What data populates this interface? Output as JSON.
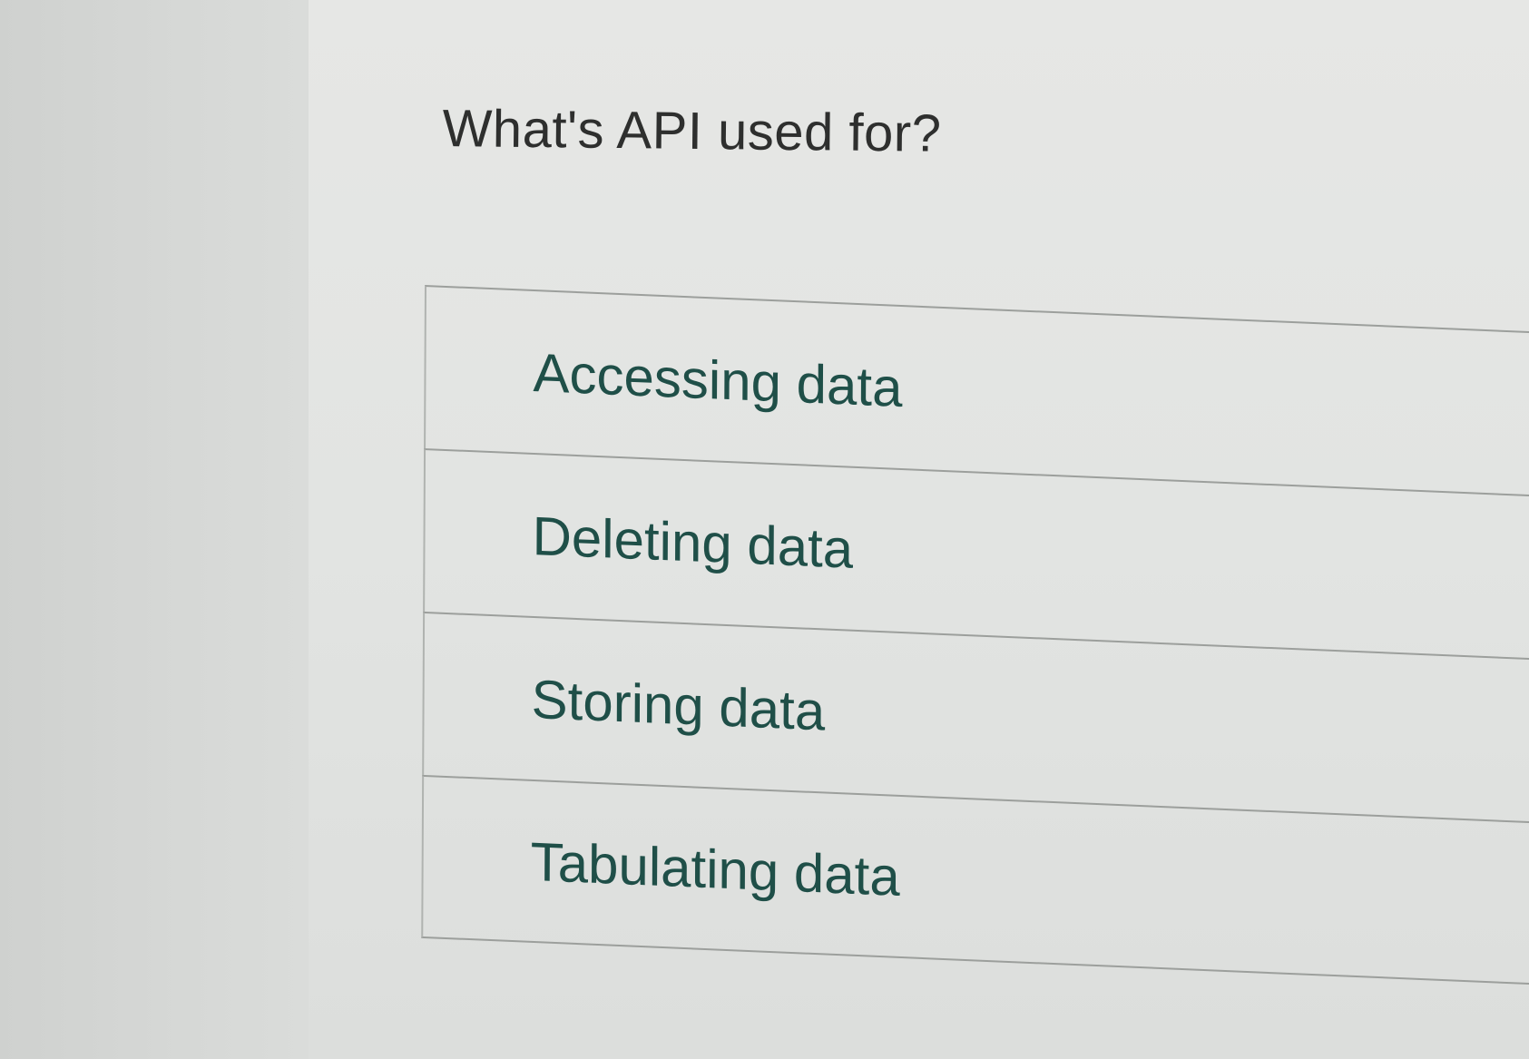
{
  "quiz": {
    "question": "What's API used for?",
    "options": [
      {
        "label": "Accessing data"
      },
      {
        "label": "Deleting data"
      },
      {
        "label": "Storing data"
      },
      {
        "label": "Tabulating data"
      }
    ]
  },
  "colors": {
    "question_text": "#2e2f2e",
    "option_text": "#1f4f48",
    "divider": "#9c9f9c",
    "background": "#e4e5e3"
  }
}
